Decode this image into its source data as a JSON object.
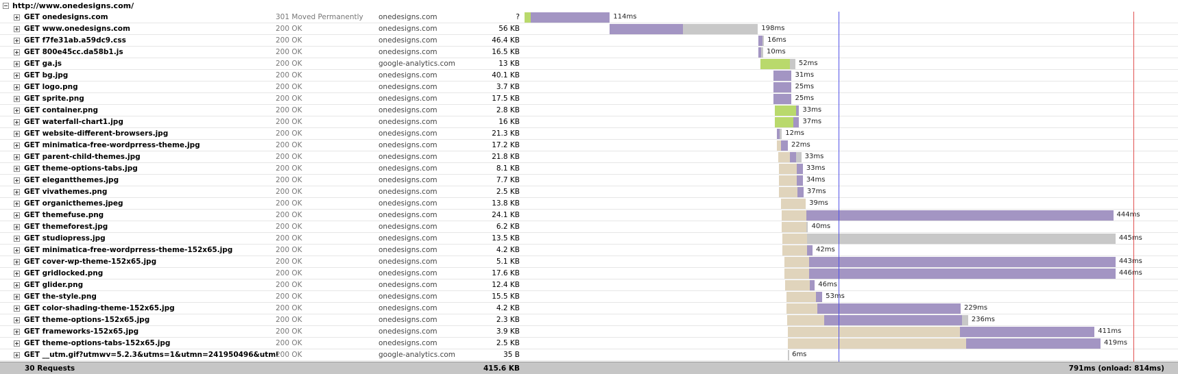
{
  "page": {
    "url": "http://www.onedesigns.com/"
  },
  "colors": {
    "blocked": "#e0d4bc",
    "connect": "#b9d96c",
    "waiting": "#a395c3",
    "receiving": "#c8c8c8",
    "dom_content_loaded_line": "#5050e6",
    "onload_line": "#e05050"
  },
  "timeline": {
    "total_ms": 814,
    "dom_content_loaded_ms": 420,
    "onload_ms": 814
  },
  "requests": [
    {
      "name": "GET onedesigns.com",
      "status": "301 Moved Permanently",
      "domain": "onedesigns.com",
      "size": "?",
      "duration": "114ms",
      "start": 0,
      "blocked": 0,
      "connect": 8,
      "waiting": 106,
      "receiving": 0
    },
    {
      "name": "GET www.onedesigns.com",
      "status": "200 OK",
      "domain": "onedesigns.com",
      "size": "56 KB",
      "duration": "198ms",
      "start": 114,
      "blocked": 0,
      "connect": 0,
      "waiting": 98,
      "receiving": 100
    },
    {
      "name": "GET f7fe31ab.a59dc9.css",
      "status": "200 OK",
      "domain": "onedesigns.com",
      "size": "46.4 KB",
      "duration": "16ms",
      "start": 313,
      "blocked": 0,
      "connect": 0,
      "waiting": 5,
      "receiving": 2
    },
    {
      "name": "GET 800e45cc.da58b1.js",
      "status": "200 OK",
      "domain": "onedesigns.com",
      "size": "16.5 KB",
      "duration": "10ms",
      "start": 313,
      "blocked": 0,
      "connect": 0,
      "waiting": 3,
      "receiving": 3
    },
    {
      "name": "GET ga.js",
      "status": "200 OK",
      "domain": "google-analytics.com",
      "size": "13 KB",
      "duration": "52ms",
      "start": 315,
      "blocked": 0,
      "connect": 40,
      "waiting": 0,
      "receiving": 7
    },
    {
      "name": "GET bg.jpg",
      "status": "200 OK",
      "domain": "onedesigns.com",
      "size": "40.1 KB",
      "duration": "31ms",
      "start": 333,
      "blocked": 0,
      "connect": 0,
      "waiting": 24,
      "receiving": 0
    },
    {
      "name": "GET logo.png",
      "status": "200 OK",
      "domain": "onedesigns.com",
      "size": "3.7 KB",
      "duration": "25ms",
      "start": 333,
      "blocked": 0,
      "connect": 0,
      "waiting": 24,
      "receiving": 0
    },
    {
      "name": "GET sprite.png",
      "status": "200 OK",
      "domain": "onedesigns.com",
      "size": "17.5 KB",
      "duration": "25ms",
      "start": 333,
      "blocked": 0,
      "connect": 0,
      "waiting": 24,
      "receiving": 0
    },
    {
      "name": "GET container.png",
      "status": "200 OK",
      "domain": "onedesigns.com",
      "size": "2.8 KB",
      "duration": "33ms",
      "start": 335,
      "blocked": 0,
      "connect": 28,
      "waiting": 4,
      "receiving": 0
    },
    {
      "name": "GET waterfall-chart1.jpg",
      "status": "200 OK",
      "domain": "onedesigns.com",
      "size": "16 KB",
      "duration": "37ms",
      "start": 335,
      "blocked": 0,
      "connect": 24,
      "waiting": 8,
      "receiving": 0
    },
    {
      "name": "GET website-different-browsers.jpg",
      "status": "200 OK",
      "domain": "onedesigns.com",
      "size": "21.3 KB",
      "duration": "12ms",
      "start": 337,
      "blocked": 0,
      "connect": 0,
      "waiting": 4,
      "receiving": 3
    },
    {
      "name": "GET minimatica-free-wordprress-theme.jpg",
      "status": "200 OK",
      "domain": "onedesigns.com",
      "size": "17.2 KB",
      "duration": "22ms",
      "start": 337,
      "blocked": 6,
      "connect": 0,
      "waiting": 9,
      "receiving": 0
    },
    {
      "name": "GET parent-child-themes.jpg",
      "status": "200 OK",
      "domain": "onedesigns.com",
      "size": "21.8 KB",
      "duration": "33ms",
      "start": 339,
      "blocked": 16,
      "connect": 0,
      "waiting": 8,
      "receiving": 7
    },
    {
      "name": "GET theme-options-tabs.jpg",
      "status": "200 OK",
      "domain": "onedesigns.com",
      "size": "8.1 KB",
      "duration": "33ms",
      "start": 340,
      "blocked": 24,
      "connect": 0,
      "waiting": 8,
      "receiving": 0
    },
    {
      "name": "GET elegantthemes.jpg",
      "status": "200 OK",
      "domain": "onedesigns.com",
      "size": "7.7 KB",
      "duration": "34ms",
      "start": 340,
      "blocked": 24,
      "connect": 0,
      "waiting": 8,
      "receiving": 0
    },
    {
      "name": "GET vivathemes.png",
      "status": "200 OK",
      "domain": "onedesigns.com",
      "size": "2.5 KB",
      "duration": "37ms",
      "start": 340,
      "blocked": 25,
      "connect": 0,
      "waiting": 8,
      "receiving": 0
    },
    {
      "name": "GET organicthemes.jpeg",
      "status": "200 OK",
      "domain": "onedesigns.com",
      "size": "13.8 KB",
      "duration": "39ms",
      "start": 343,
      "blocked": 33,
      "connect": 0,
      "waiting": 0,
      "receiving": 0
    },
    {
      "name": "GET themefuse.png",
      "status": "200 OK",
      "domain": "onedesigns.com",
      "size": "24.1 KB",
      "duration": "444ms",
      "start": 344,
      "blocked": 33,
      "connect": 0,
      "waiting": 410,
      "receiving": 0
    },
    {
      "name": "GET themeforest.jpg",
      "status": "200 OK",
      "domain": "onedesigns.com",
      "size": "6.2 KB",
      "duration": "40ms",
      "start": 344,
      "blocked": 33,
      "connect": 0,
      "waiting": 0,
      "receiving": 2
    },
    {
      "name": "GET studiopress.jpg",
      "status": "200 OK",
      "domain": "onedesigns.com",
      "size": "13.5 KB",
      "duration": "445ms",
      "start": 345,
      "blocked": 33,
      "connect": 0,
      "waiting": 0,
      "receiving": 412
    },
    {
      "name": "GET minimatica-free-wordprress-theme-152x65.jpg",
      "status": "200 OK",
      "domain": "onedesigns.com",
      "size": "4.2 KB",
      "duration": "42ms",
      "start": 345,
      "blocked": 33,
      "connect": 0,
      "waiting": 7,
      "receiving": 0
    },
    {
      "name": "GET cover-wp-theme-152x65.jpg",
      "status": "200 OK",
      "domain": "onedesigns.com",
      "size": "5.1 KB",
      "duration": "443ms",
      "start": 347,
      "blocked": 33,
      "connect": 0,
      "waiting": 410,
      "receiving": 0
    },
    {
      "name": "GET gridlocked.png",
      "status": "200 OK",
      "domain": "onedesigns.com",
      "size": "17.6 KB",
      "duration": "446ms",
      "start": 347,
      "blocked": 33,
      "connect": 0,
      "waiting": 410,
      "receiving": 0
    },
    {
      "name": "GET glider.png",
      "status": "200 OK",
      "domain": "onedesigns.com",
      "size": "12.4 KB",
      "duration": "46ms",
      "start": 348,
      "blocked": 33,
      "connect": 0,
      "waiting": 7,
      "receiving": 0
    },
    {
      "name": "GET the-style.png",
      "status": "200 OK",
      "domain": "onedesigns.com",
      "size": "15.5 KB",
      "duration": "53ms",
      "start": 350,
      "blocked": 40,
      "connect": 0,
      "waiting": 8,
      "receiving": 0
    },
    {
      "name": "GET color-shading-theme-152x65.jpg",
      "status": "200 OK",
      "domain": "onedesigns.com",
      "size": "4.2 KB",
      "duration": "229ms",
      "start": 350,
      "blocked": 41,
      "connect": 0,
      "waiting": 192,
      "receiving": 0
    },
    {
      "name": "GET theme-options-152x65.jpg",
      "status": "200 OK",
      "domain": "onedesigns.com",
      "size": "2.3 KB",
      "duration": "236ms",
      "start": 351,
      "blocked": 50,
      "connect": 0,
      "waiting": 184,
      "receiving": 8
    },
    {
      "name": "GET frameworks-152x65.jpg",
      "status": "200 OK",
      "domain": "onedesigns.com",
      "size": "3.9 KB",
      "duration": "411ms",
      "start": 352,
      "blocked": 230,
      "connect": 0,
      "waiting": 180,
      "receiving": 0
    },
    {
      "name": "GET theme-options-tabs-152x65.jpg",
      "status": "200 OK",
      "domain": "onedesigns.com",
      "size": "2.5 KB",
      "duration": "419ms",
      "start": 352,
      "blocked": 238,
      "connect": 0,
      "waiting": 180,
      "receiving": 0
    },
    {
      "name": "GET __utm.gif?utmwv=5.2.3&utms=1&utmn=241950496&utml",
      "status": "200 OK",
      "domain": "google-analytics.com",
      "size": "35 B",
      "duration": "6ms",
      "start": 352,
      "blocked": 0,
      "connect": 0,
      "waiting": 0,
      "receiving": 1
    }
  ],
  "footer": {
    "requests": "30 Requests",
    "total_size": "415.6 KB",
    "total_time": "791ms (onload: 814ms)"
  }
}
